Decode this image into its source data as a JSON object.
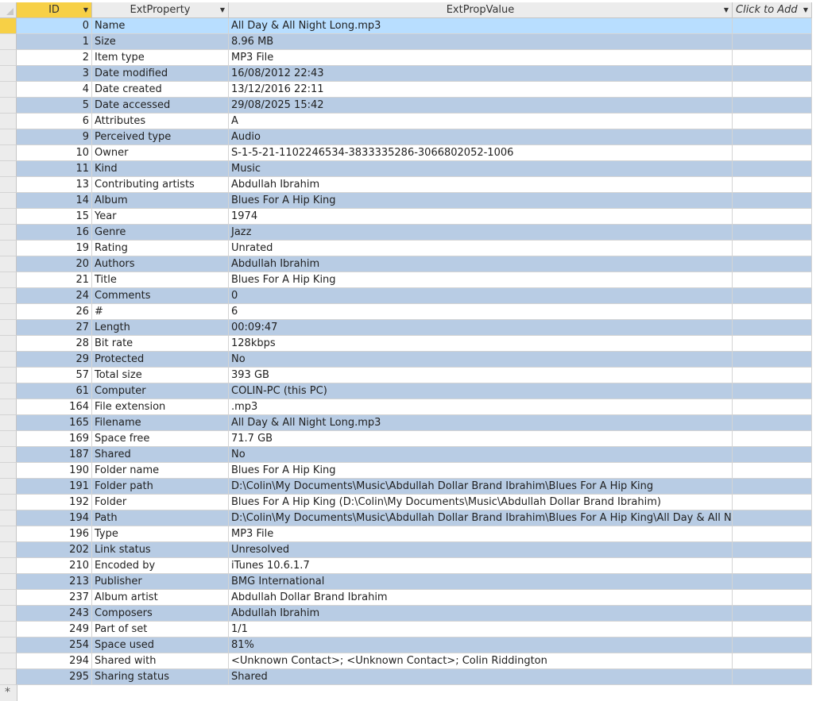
{
  "headers": {
    "id": "ID",
    "prop": "ExtProperty",
    "val": "ExtPropValue",
    "add": "Click to Add"
  },
  "new_record_glyph": "*",
  "rows": [
    {
      "id": "0",
      "prop": "Name",
      "val": "All Day & All Night Long.mp3"
    },
    {
      "id": "1",
      "prop": "Size",
      "val": "8.96 MB"
    },
    {
      "id": "2",
      "prop": "Item type",
      "val": "MP3 File"
    },
    {
      "id": "3",
      "prop": "Date modified",
      "val": "16/08/2012 22:43"
    },
    {
      "id": "4",
      "prop": "Date created",
      "val": "13/12/2016 22:11"
    },
    {
      "id": "5",
      "prop": "Date accessed",
      "val": "29/08/2025 15:42"
    },
    {
      "id": "6",
      "prop": "Attributes",
      "val": "A"
    },
    {
      "id": "9",
      "prop": "Perceived type",
      "val": "Audio"
    },
    {
      "id": "10",
      "prop": "Owner",
      "val": "S-1-5-21-1102246534-3833335286-3066802052-1006"
    },
    {
      "id": "11",
      "prop": "Kind",
      "val": "Music"
    },
    {
      "id": "13",
      "prop": "Contributing artists",
      "val": "Abdullah Ibrahim"
    },
    {
      "id": "14",
      "prop": "Album",
      "val": "Blues For A Hip King"
    },
    {
      "id": "15",
      "prop": "Year",
      "val": "1974"
    },
    {
      "id": "16",
      "prop": "Genre",
      "val": "Jazz"
    },
    {
      "id": "19",
      "prop": "Rating",
      "val": "Unrated"
    },
    {
      "id": "20",
      "prop": "Authors",
      "val": "Abdullah Ibrahim"
    },
    {
      "id": "21",
      "prop": "Title",
      "val": "Blues For A Hip King"
    },
    {
      "id": "24",
      "prop": "Comments",
      "val": "0"
    },
    {
      "id": "26",
      "prop": "#",
      "val": "6"
    },
    {
      "id": "27",
      "prop": "Length",
      "val": "00:09:47"
    },
    {
      "id": "28",
      "prop": "Bit rate",
      "val": "128kbps"
    },
    {
      "id": "29",
      "prop": "Protected",
      "val": "No"
    },
    {
      "id": "57",
      "prop": "Total size",
      "val": "393 GB"
    },
    {
      "id": "61",
      "prop": "Computer",
      "val": "COLIN-PC (this PC)"
    },
    {
      "id": "164",
      "prop": "File extension",
      "val": ".mp3"
    },
    {
      "id": "165",
      "prop": "Filename",
      "val": "All Day & All Night Long.mp3"
    },
    {
      "id": "169",
      "prop": "Space free",
      "val": "71.7 GB"
    },
    {
      "id": "187",
      "prop": "Shared",
      "val": "No"
    },
    {
      "id": "190",
      "prop": "Folder name",
      "val": "Blues For A Hip King"
    },
    {
      "id": "191",
      "prop": "Folder path",
      "val": "D:\\Colin\\My Documents\\Music\\Abdullah Dollar Brand Ibrahim\\Blues For A Hip King"
    },
    {
      "id": "192",
      "prop": "Folder",
      "val": "Blues For A Hip King (D:\\Colin\\My Documents\\Music\\Abdullah Dollar Brand Ibrahim)"
    },
    {
      "id": "194",
      "prop": "Path",
      "val": "D:\\Colin\\My Documents\\Music\\Abdullah Dollar Brand Ibrahim\\Blues For A Hip King\\All Day & All Night"
    },
    {
      "id": "196",
      "prop": "Type",
      "val": "MP3 File"
    },
    {
      "id": "202",
      "prop": "Link status",
      "val": "Unresolved"
    },
    {
      "id": "210",
      "prop": "Encoded by",
      "val": "iTunes 10.6.1.7"
    },
    {
      "id": "213",
      "prop": "Publisher",
      "val": "BMG International"
    },
    {
      "id": "237",
      "prop": "Album artist",
      "val": "Abdullah Dollar Brand Ibrahim"
    },
    {
      "id": "243",
      "prop": "Composers",
      "val": "Abdullah Ibrahim"
    },
    {
      "id": "249",
      "prop": "Part of set",
      "val": "1/1"
    },
    {
      "id": "254",
      "prop": "Space used",
      "val": "81%"
    },
    {
      "id": "294",
      "prop": "Shared with",
      "val": "<Unknown Contact>; <Unknown Contact>; Colin Riddington"
    },
    {
      "id": "295",
      "prop": "Sharing status",
      "val": "Shared"
    }
  ]
}
